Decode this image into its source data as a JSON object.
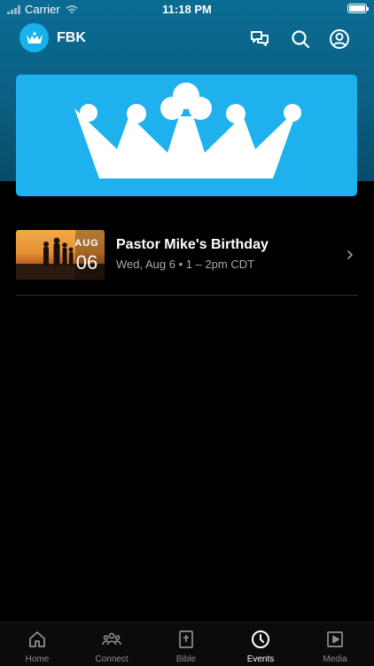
{
  "status_bar": {
    "carrier": "Carrier",
    "time": "11:18 PM"
  },
  "header": {
    "org_name": "FBK",
    "icons": [
      "chat-icon",
      "search-icon",
      "profile-icon"
    ]
  },
  "banner": {
    "icon": "crown-logo",
    "background": "#1eb1ed"
  },
  "events": [
    {
      "month": "AUG",
      "day": "06",
      "title": "Pastor Mike's Birthday",
      "meta": "Wed, Aug 6 • 1 – 2pm CDT"
    }
  ],
  "tabs": [
    {
      "label": "Home",
      "icon": "home-icon",
      "active": false
    },
    {
      "label": "Connect",
      "icon": "people-icon",
      "active": false
    },
    {
      "label": "Bible",
      "icon": "bible-icon",
      "active": false
    },
    {
      "label": "Events",
      "icon": "clock-icon",
      "active": true
    },
    {
      "label": "Media",
      "icon": "play-icon",
      "active": false
    }
  ],
  "colors": {
    "header_top": "#0b6c93",
    "accent": "#1eb1ed",
    "background": "#000000"
  }
}
